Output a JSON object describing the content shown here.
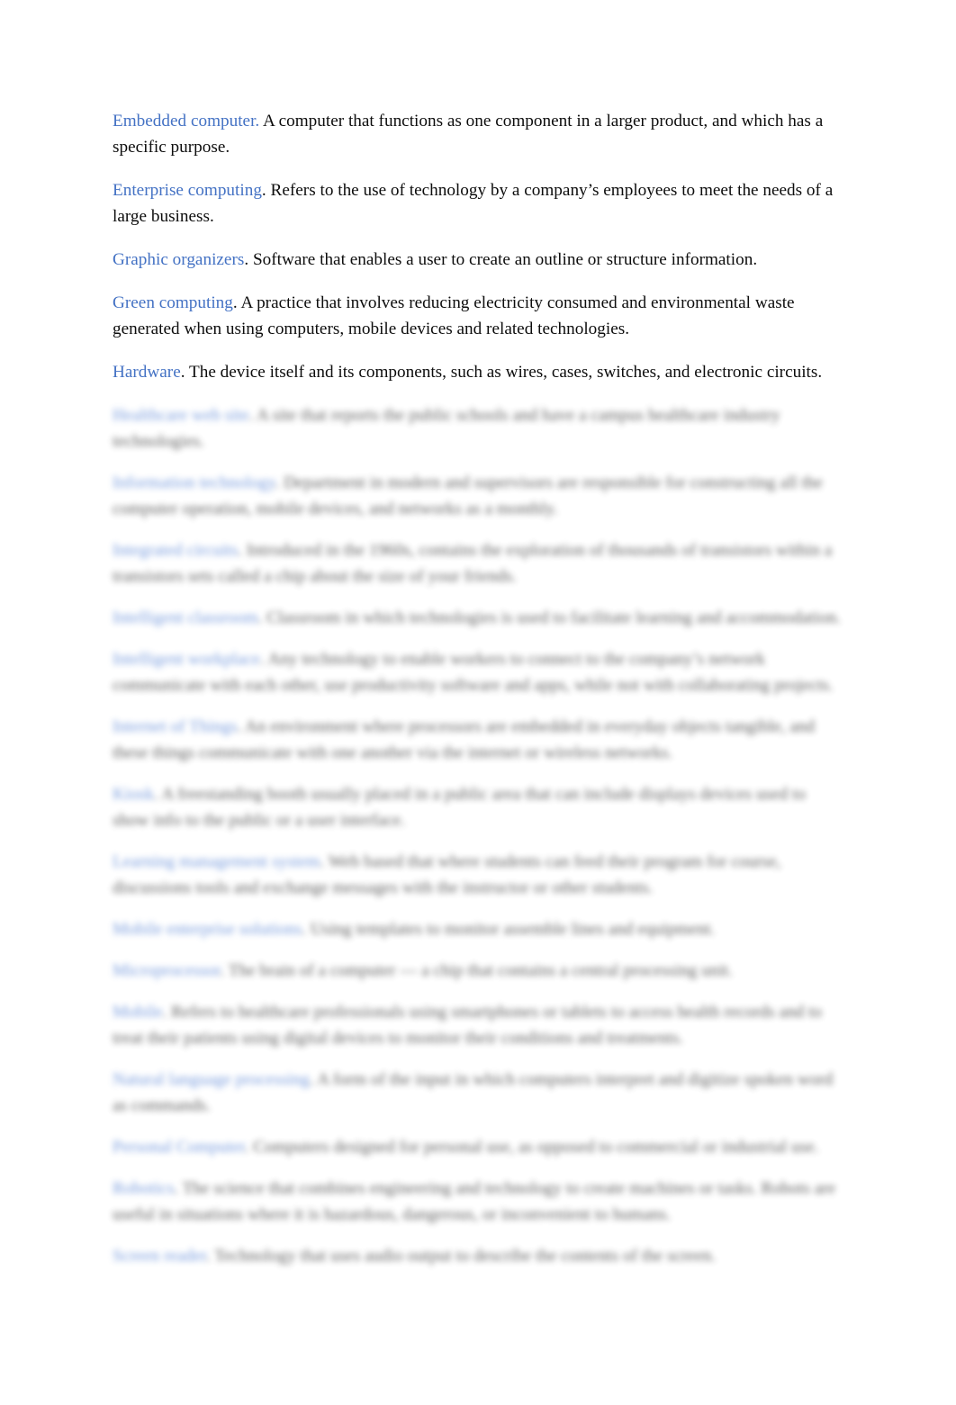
{
  "document": {
    "type": "glossary",
    "page_background": "#ffffff",
    "term_color": "#4472C4",
    "body_color": "#0d0d0d"
  },
  "entries_clear": [
    {
      "term": "Embedded computer.",
      "definition": "  A computer that functions as one component in a larger product, and which has a specific purpose."
    },
    {
      "term": "Enterprise computing",
      "definition": ". Refers to the use of technology by a company’s employees to meet the needs of a large business."
    },
    {
      "term": "Graphic organizers",
      "definition": ". Software that enables a user to create an outline or structure information."
    },
    {
      "term": "Green computing",
      "definition": ". A practice that involves reducing electricity consumed and environmental waste generated when using computers, mobile devices and related technologies."
    },
    {
      "term": "Hardware",
      "definition": ". The device itself and its components, such as wires, cases, switches, and electronic circuits."
    }
  ],
  "entries_obscured": [
    {
      "term": "Healthcare web site",
      "definition": ". A site that reports the public schools and have a campus healthcare industry technologies."
    },
    {
      "term": "Information technology",
      "definition": ". Department in modern and supervisors are responsible for constructing all the computer operation, mobile devices, and networks as a monthly."
    },
    {
      "term": "Integrated circuits",
      "definition": ". Introduced in the 1960s, contains the exploration of thousands of transistors within a transistors sets called a chip about the size of your friends."
    },
    {
      "term": "Intelligent classroom",
      "definition": ". Classroom in which technologies is used to facilitate learning and accommodation."
    },
    {
      "term": "Intelligent workplace",
      "definition": ". Any technology to enable workers to connect to the company’s network communicate with each other, use productivity software and apps, while not with collaborating projects."
    },
    {
      "term": "Internet of Things",
      "definition": ". An environment where processors are embedded in everyday objects tangible, and these things communicate with one another via the internet or wireless networks."
    },
    {
      "term": "Kiosk",
      "definition": ". A freestanding booth usually placed in a public area that can include displays devices used to show info to the public or a user interface."
    },
    {
      "term": "Learning management system",
      "definition": ". Web based that where students can feed their program for course, discussions tools and exchange messages with the instructor or other students."
    },
    {
      "term": "Mobile enterprise solutions",
      "definition": ". Using templates to monitor assemble lines and equipment."
    },
    {
      "term": "Microprocessor",
      "definition": ". The brain of a computer — a chip that contains a central processing unit."
    },
    {
      "term": "Mobile",
      "definition": ". Refers to healthcare professionals using smartphones or tablets to access health records and to treat their patients using digital devices to monitor their conditions and treatments."
    },
    {
      "term": "Natural language processing",
      "definition": ". A form of the input in which computers interpret and digitize spoken word as commands."
    },
    {
      "term": "Personal Computer",
      "definition": ". Computers designed for personal use, as opposed to commercial or industrial use."
    },
    {
      "term": "Robotics",
      "definition": ". The science that combines engineering and technology to create machines or tasks. Robots are useful in situations where it is hazardous, dangerous, or inconvenient to humans."
    },
    {
      "term": "Screen reader",
      "definition": ". Technology that uses audio output to describe the contents of the screen."
    }
  ]
}
